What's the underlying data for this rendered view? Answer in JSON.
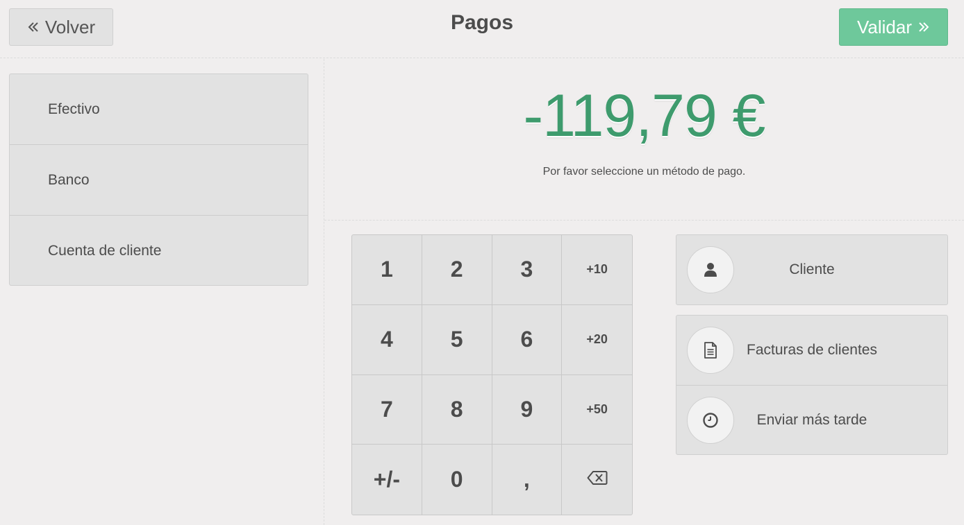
{
  "header": {
    "back_label": "Volver",
    "title": "Pagos",
    "validate_label": "Validar"
  },
  "payment_methods": [
    {
      "label": "Efectivo"
    },
    {
      "label": "Banco"
    },
    {
      "label": "Cuenta de cliente"
    }
  ],
  "summary": {
    "amount": "-119,79 €",
    "hint": "Por favor seleccione un método de pago."
  },
  "numpad": {
    "keys": [
      "1",
      "2",
      "3",
      "+10",
      "4",
      "5",
      "6",
      "+20",
      "7",
      "8",
      "9",
      "+50",
      "+/-",
      "0",
      ","
    ]
  },
  "actions": {
    "customer": {
      "label": "Cliente",
      "icon": "user-icon"
    },
    "invoice": {
      "label": "Facturas de clientes",
      "icon": "file-text-icon"
    },
    "send_later": {
      "label": "Enviar más tarde",
      "icon": "clock-icon"
    }
  },
  "colors": {
    "accent_green": "#6ec89b",
    "amount_green": "#3e9b6d",
    "background": "#f0eeee",
    "panel": "#e2e2e2"
  }
}
